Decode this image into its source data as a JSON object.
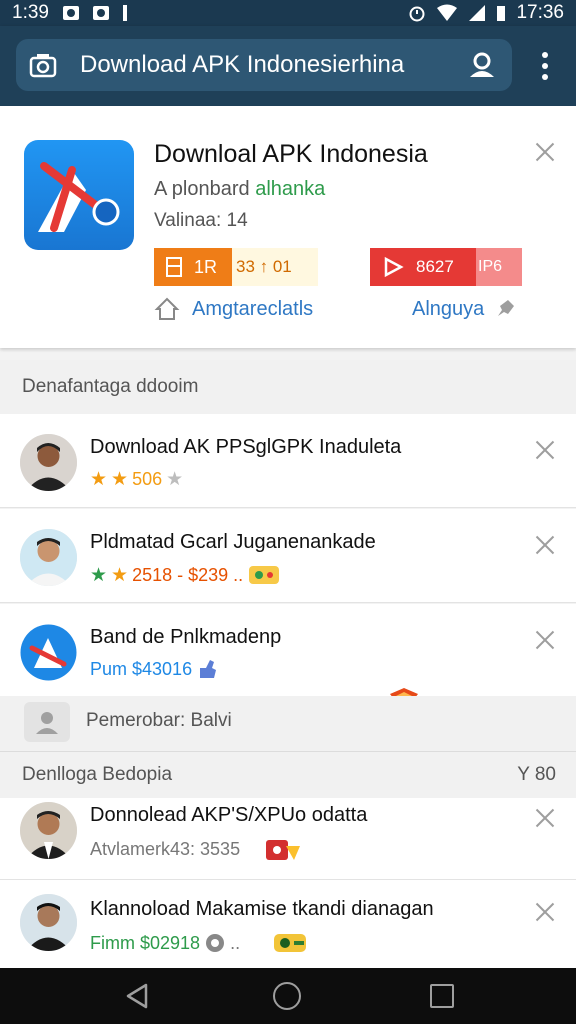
{
  "status_bar": {
    "time_left": "1:39",
    "time_right": "17:36"
  },
  "app_bar": {
    "title": "Download APK Indonesierhina"
  },
  "feature": {
    "title": "Downloal APK Indonesia",
    "subtitle_prefix": "A plonbard",
    "subtitle_highlight": "alhanka",
    "version": "Valinaa: 14",
    "badge_orange_left": "1R",
    "badge_orange_right": "33 ↑ 01",
    "badge_red_left": "8627",
    "badge_red_right": "IP6",
    "link_left": "Amgtareclatls",
    "link_right": "Alnguya"
  },
  "section_1": {
    "label": "Denafantaga ddooim"
  },
  "rows_1": [
    {
      "title": "Download AK PPSglGPK Inaduleta",
      "meta": "506",
      "meta_color": "#f39c12"
    },
    {
      "title": "Pldmatad Gcarl Juganenankade",
      "meta": "2518 - $239 ..",
      "meta_color": "#e65100"
    },
    {
      "title": "Band de Pnlkmadenp",
      "meta": "Pum $43016",
      "meta_color": "#1e88e5"
    }
  ],
  "search_row": {
    "label": "Pemerobar: Balvi"
  },
  "section_2": {
    "label": "Denlloga Bedopia",
    "right": "Y 80"
  },
  "rows_2": [
    {
      "title": "Donnolead AKP'S/XPUo odatta",
      "meta": "Atvlamerk43: 3535",
      "meta_color": "#777777"
    },
    {
      "title": "Klannoload Makamise tkandi dianagan",
      "meta": "Fimm $02918",
      "meta_color": "#2e9b4b"
    }
  ],
  "colors": {
    "appbar": "#1f4058",
    "accent_blue": "#2f78c4",
    "orange": "#ef7d17",
    "red": "#e53935"
  }
}
